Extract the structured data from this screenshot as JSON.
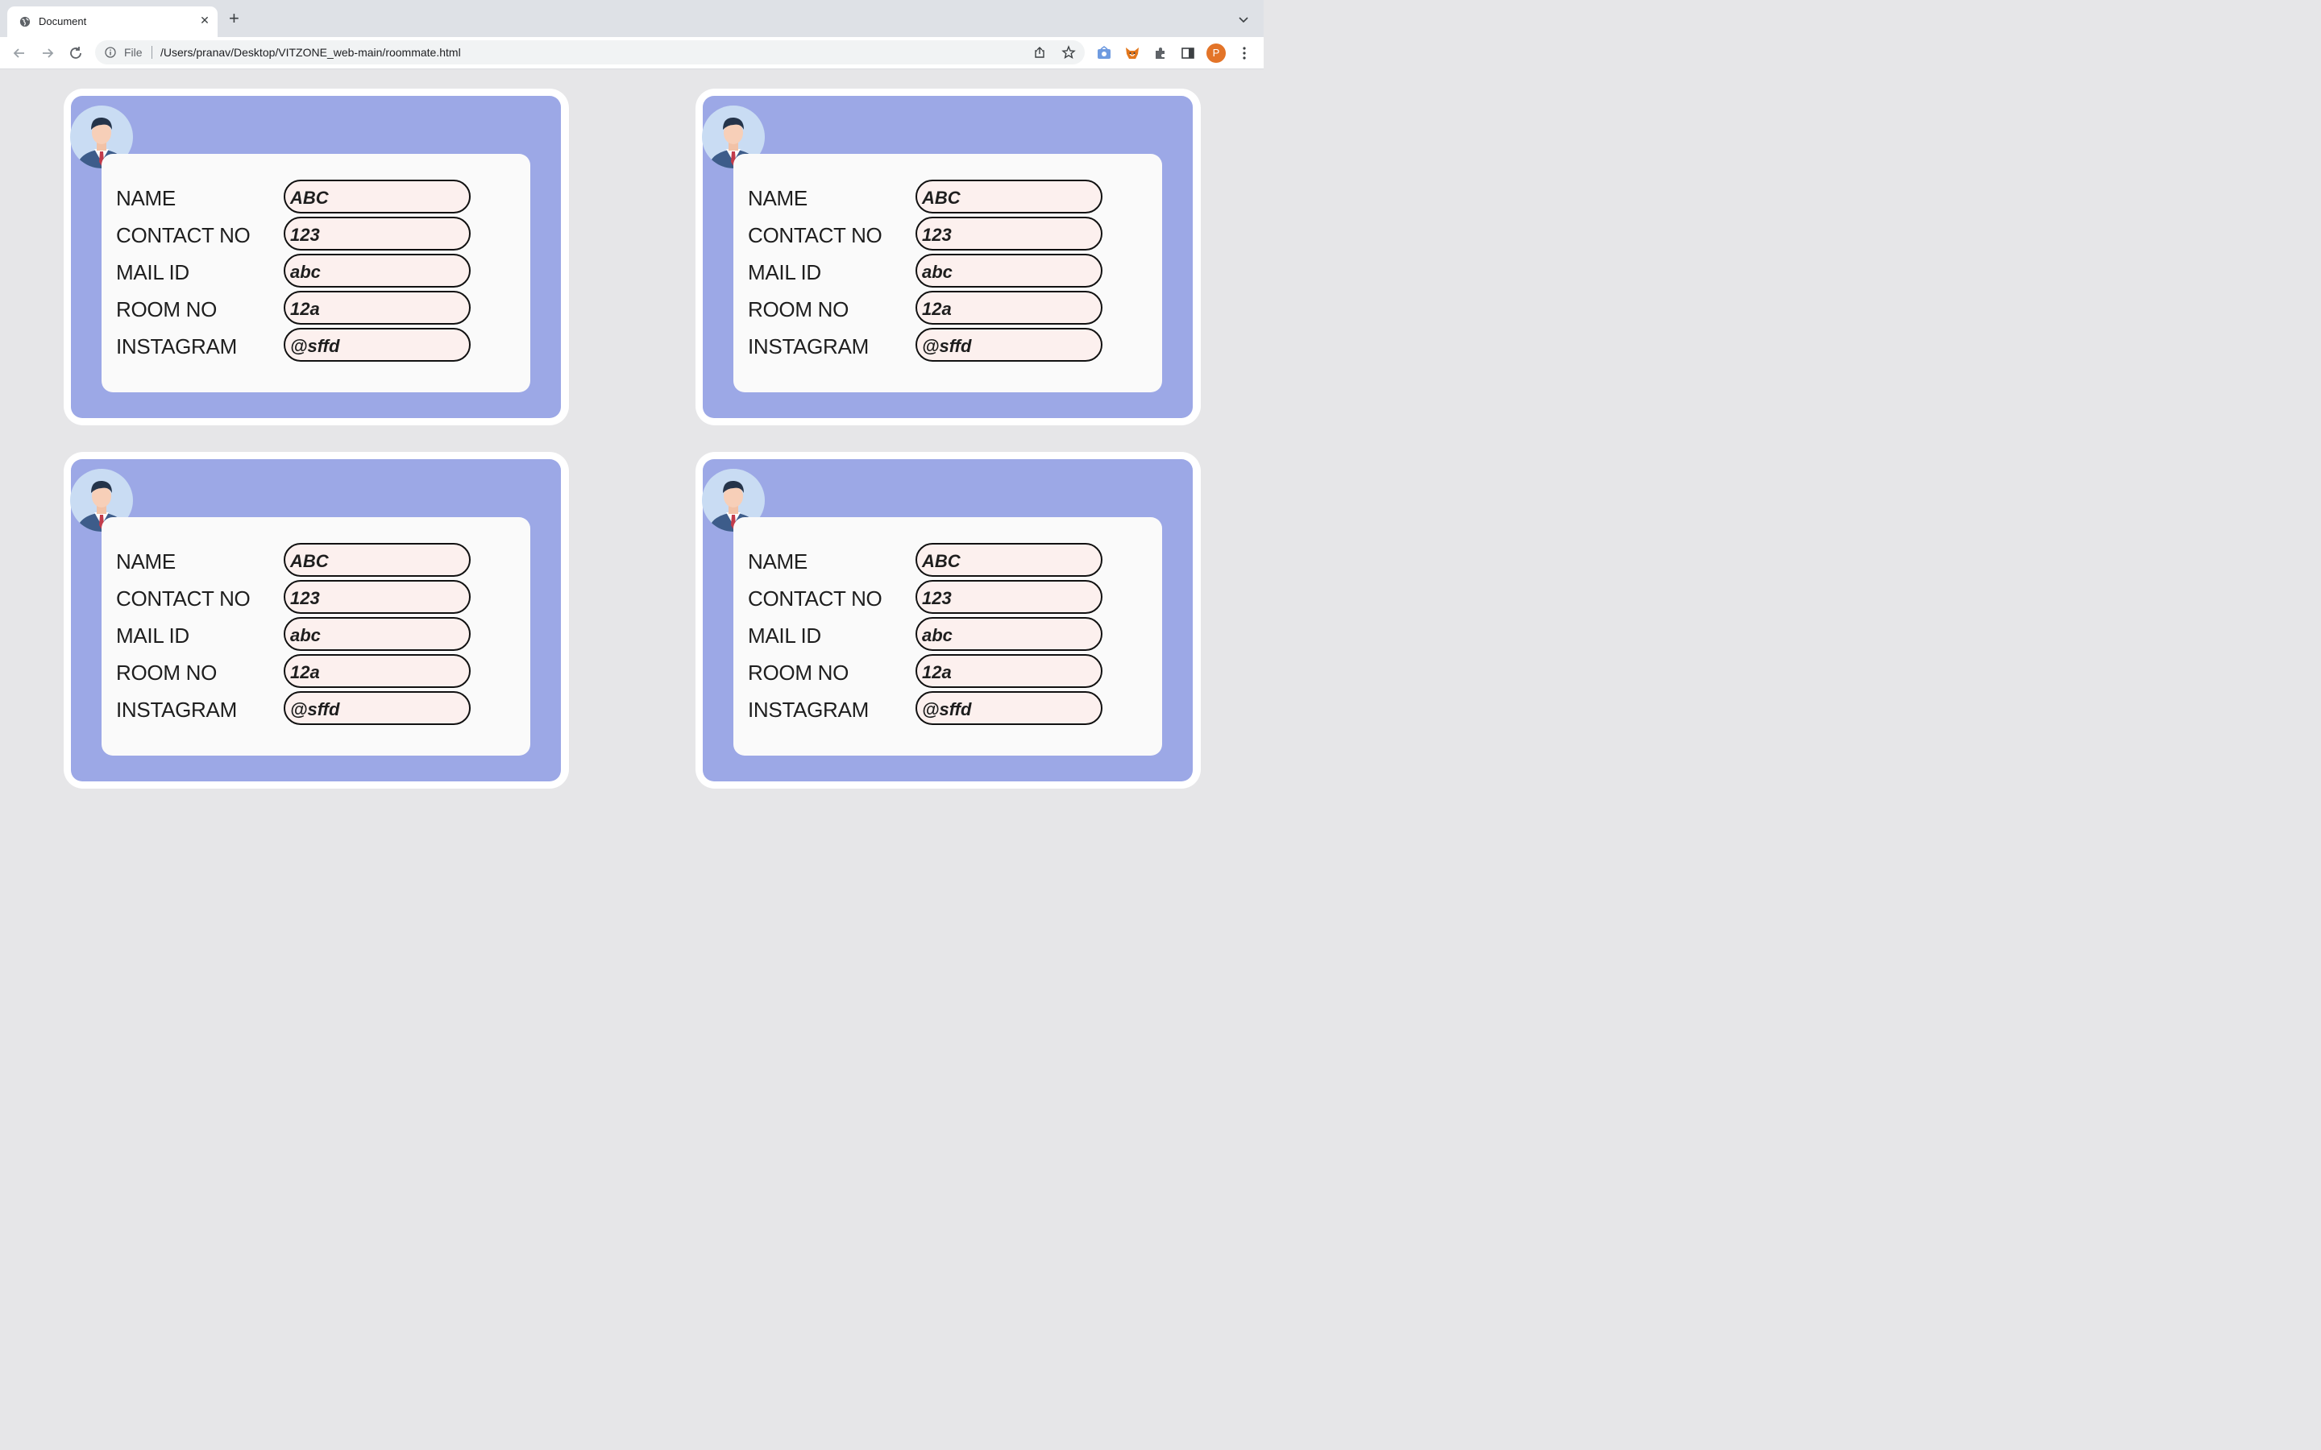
{
  "browser": {
    "tab_title": "Document",
    "new_tab": "+",
    "address_scheme": "File",
    "address_url": "/Users/pranav/Desktop/VITZONE_web-main/roommate.html",
    "profile_initial": "P",
    "profile_color": "#e37428",
    "icons": [
      "globe-icon",
      "close-icon",
      "chevron-down-icon",
      "back-icon",
      "forward-icon",
      "reload-icon",
      "info-icon",
      "share-icon",
      "star-icon",
      "extension-icon",
      "fox-icon",
      "puzzle-icon",
      "sidebar-icon",
      "more-icon"
    ]
  },
  "colors": {
    "page_bg": "#e6e6e8",
    "card_outer": "#ffffff",
    "card_inner": "#9ca8e6",
    "panel": "#fafafa",
    "field_bg": "#fcf0ee"
  },
  "cards": [
    {
      "fields": [
        {
          "label": "NAME",
          "value": "ABC"
        },
        {
          "label": "CONTACT NO",
          "value": "123"
        },
        {
          "label": "MAIL ID",
          "value": "abc"
        },
        {
          "label": "ROOM NO",
          "value": "12a"
        },
        {
          "label": "INSTAGRAM",
          "value": "@sffd"
        }
      ]
    },
    {
      "fields": [
        {
          "label": "NAME",
          "value": "ABC"
        },
        {
          "label": "CONTACT NO",
          "value": "123"
        },
        {
          "label": "MAIL ID",
          "value": "abc"
        },
        {
          "label": "ROOM NO",
          "value": "12a"
        },
        {
          "label": "INSTAGRAM",
          "value": "@sffd"
        }
      ]
    },
    {
      "fields": [
        {
          "label": "NAME",
          "value": "ABC"
        },
        {
          "label": "CONTACT NO",
          "value": "123"
        },
        {
          "label": "MAIL ID",
          "value": "abc"
        },
        {
          "label": "ROOM NO",
          "value": "12a"
        },
        {
          "label": "INSTAGRAM",
          "value": "@sffd"
        }
      ]
    },
    {
      "fields": [
        {
          "label": "NAME",
          "value": "ABC"
        },
        {
          "label": "CONTACT NO",
          "value": "123"
        },
        {
          "label": "MAIL ID",
          "value": "abc"
        },
        {
          "label": "ROOM NO",
          "value": "12a"
        },
        {
          "label": "INSTAGRAM",
          "value": "@sffd"
        }
      ]
    }
  ]
}
